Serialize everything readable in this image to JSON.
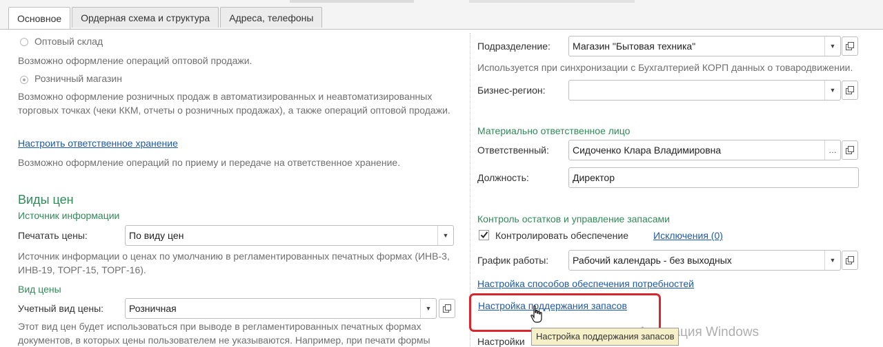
{
  "tabs": [
    {
      "label": "Основное"
    },
    {
      "label": "Ордерная схема и структура"
    },
    {
      "label": "Адреса, телефоны"
    }
  ],
  "left": {
    "wholesale_label": "Оптовый склад",
    "wholesale_desc": "Возможно оформление операций оптовой продажи.",
    "retail_label": "Розничный магазин",
    "retail_desc": "Возможно оформление розничных продаж в автоматизированных и неавтоматизированных торговых точках (чеки ККМ, отчеты о розничных продажах), а также операций оптовой продажи.",
    "custody_link": "Настроить ответственное хранение",
    "custody_desc": "Возможно оформление операций по приему и передаче на ответственное хранение.",
    "price_types_title": "Виды цен",
    "info_source_title": "Источник информации",
    "print_prices_label": "Печатать цены:",
    "print_prices_value": "По виду цен",
    "info_source_desc": "Источник информации о ценах по умолчанию в регламентированных печатных формах (ИНВ-3, ИНВ-19, ТОРГ-15, ТОРГ-16).",
    "price_type_title": "Вид цены",
    "account_price_label": "Учетный вид цены:",
    "account_price_value": "Розничная",
    "price_type_desc": "Этот вид цен будет использоваться при выводе в регламентированных печатных формах документов, в которых цены пользователем не указываются. Например, при печати формы"
  },
  "right": {
    "division_label": "Подразделение:",
    "division_value": "Магазин \"Бытовая техника\"",
    "division_desc": "Используется при синхронизации с Бухгалтерией КОРП данных о товародвижении.",
    "region_label": "Бизнес-регион:",
    "region_value": "",
    "mol_title": "Материально ответственное лицо",
    "responsible_label": "Ответственный:",
    "responsible_value": "Сидоченко Клара Владимировна",
    "position_label": "Должность:",
    "position_value": "Директор",
    "stock_title": "Контроль остатков и управление запасами",
    "control_supply_label": "Контролировать обеспечение",
    "control_supply_checked": true,
    "exceptions_link": "Исключения (0)",
    "schedule_label": "График работы:",
    "schedule_value": "Рабочий календарь - без выходных",
    "supply_methods_link": "Настройка способов обеспечения потребностей",
    "stock_support_link": "Настройка поддержания запасов",
    "settings_partial": "Настройки",
    "tooltip": "Настройка поддержания запасов"
  },
  "watermark": "Активация Windows",
  "colors": {
    "accent_green": "#2f8a57",
    "link_blue": "#1c5aa8",
    "highlight_red": "#d9262c",
    "tooltip_bg": "#f6f0c8"
  }
}
